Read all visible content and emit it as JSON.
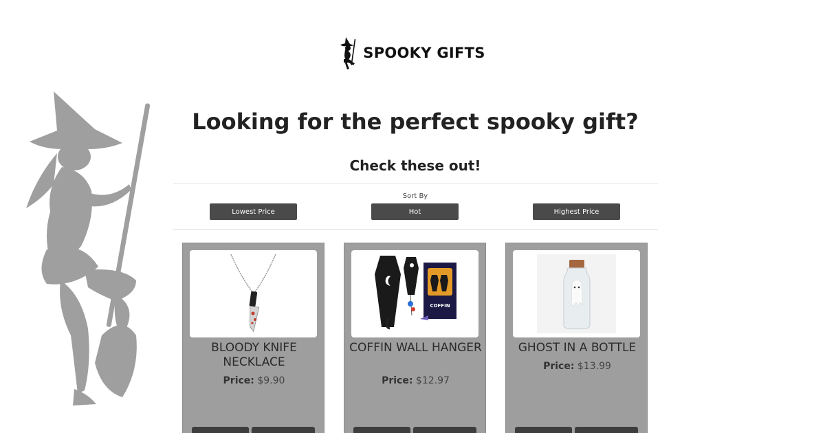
{
  "brand": {
    "name": "SPOOKY GIFTS",
    "logo_icon": "witch-icon"
  },
  "hero": {
    "title": "Looking for the perfect spooky gift?",
    "subtitle": "Check these out!"
  },
  "sort": {
    "label": "Sort By",
    "options": [
      "Lowest Price",
      "Hot",
      "Highest Price"
    ]
  },
  "products": [
    {
      "name": "BLOODY KNIFE NECKLACE",
      "price_label": "Price:",
      "price": "$9.90"
    },
    {
      "name": "COFFIN WALL HANGER",
      "price_label": "Price:",
      "price": "$12.97"
    },
    {
      "name": "GHOST IN A BOTTLE",
      "price_label": "Price:",
      "price": "$13.99"
    }
  ],
  "product_image_text": {
    "coffin_box": "COFFIN"
  },
  "colors": {
    "button_bg": "#4a4a4a",
    "card_bg": "#9e9e9e",
    "witch_silhouette": "#9a9a9a"
  }
}
